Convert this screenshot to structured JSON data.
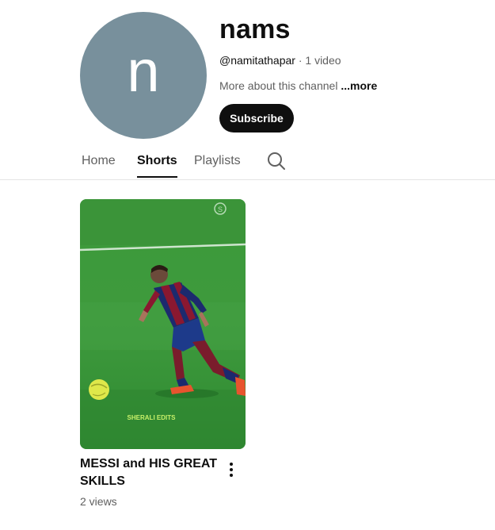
{
  "channel": {
    "avatar_letter": "n",
    "name": "nams",
    "handle": "@namitathapar",
    "separator": " · ",
    "video_count": "1 video",
    "about_text": "More about this channel ",
    "about_more": "...more",
    "subscribe_label": "Subscribe",
    "avatar_color": "#78909c"
  },
  "tabs": [
    {
      "label": "Home",
      "active": false
    },
    {
      "label": "Shorts",
      "active": true
    },
    {
      "label": "Playlists",
      "active": false
    }
  ],
  "search_icon": "search-icon",
  "shorts": [
    {
      "title": "MESSI and HIS GREAT SKILLS",
      "views": "2 views",
      "watermark": "SHERALI EDITS",
      "menu_icon": "more-vert-icon"
    }
  ]
}
